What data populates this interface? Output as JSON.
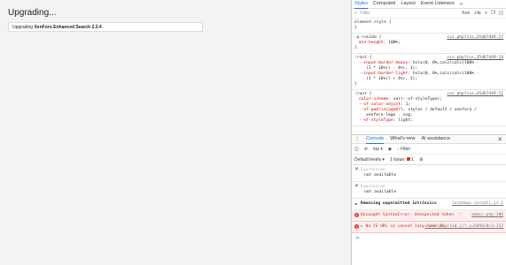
{
  "page": {
    "title": "Upgrading...",
    "progress_prefix": "Upgrading ",
    "progress_product": "XenForo Enhanced Search 2.3.4",
    "progress_suffix": " ."
  },
  "devtools": {
    "tabs": [
      "Styles",
      "Computed",
      "Layout",
      "Event Listeners"
    ],
    "more_tabs_glyph": "»",
    "filter_placeholder": "Filter",
    "toolbar": [
      ":hov",
      ".cls",
      "+"
    ],
    "styles": [
      {
        "selector": "element.style {",
        "source": "",
        "props": [],
        "close": "}"
      },
      {
        "selector": ".p-runJob {",
        "source": "css.php?css…35d67449:17",
        "props": [
          {
            "name": "min-height",
            "value": "100%;"
          }
        ],
        "close": "}"
      },
      {
        "selector": ":root {",
        "source": "css.php?css…35d67449:14",
        "props": [
          {
            "name": "--input-border-heavy",
            "value": "hsla(0, 0%,calc(calc(100% -",
            "cont": "(1 * 16%)) - 4%), 1);"
          },
          {
            "name": "--input-border-light",
            "value": "hsla(0, 0%,calc(calc(100% -",
            "cont": "(1 * 16%)) + 4%), 1);"
          }
        ],
        "close": "}"
      },
      {
        "selector": ":root {",
        "source": "css.php?css…35d67449:11",
        "props": [
          {
            "name": "color-scheme",
            "value": "var(--xf-styleType);"
          },
          {
            "name": "--xf-color-adjust",
            "value": "1;"
          },
          {
            "name": "--xf-publicLogoUrl",
            "value": "styles / default / xenforo /",
            "cont": "xenforo-logo . svg;"
          },
          {
            "name": "--xf-styleType",
            "value": "light;"
          }
        ],
        "close": ""
      }
    ],
    "drawer_tabs": [
      "Console",
      "What's new",
      "AI assistance"
    ],
    "console_context": "top",
    "console_filter": "Filter",
    "levels_label": "Default levels",
    "issues_label": "1 Issue:",
    "issues_count": "1",
    "messages": [
      {
        "kind": "eval",
        "label": "Expression",
        "value": "not available"
      },
      {
        "kind": "eval",
        "label": "Expression",
        "value": "not available"
      },
      {
        "kind": "log",
        "text": "Removing unpermitted intrinsics",
        "src": "lockdown-install.js:1"
      },
      {
        "kind": "error",
        "text": "Uncaught SyntaxError: Unexpected token ':'",
        "src": "admin.php:196"
      },
      {
        "kind": "error",
        "text": "No JS URL so cannot lazy-load JS",
        "src": "core-compiled.js?_v=5094c0c3:132"
      }
    ],
    "prompt_glyph": ">"
  }
}
